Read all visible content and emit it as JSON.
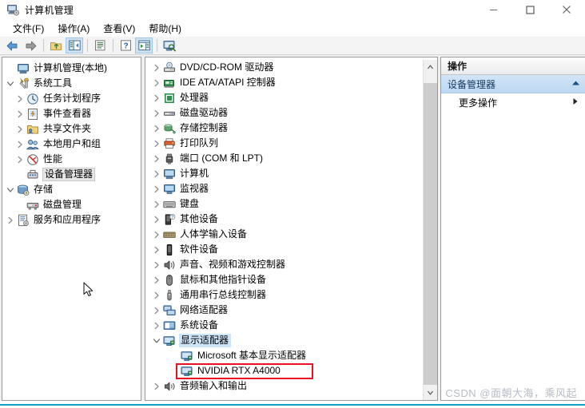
{
  "window": {
    "title": "计算机管理",
    "app_icon": "computer-management-icon",
    "controls": {
      "minimize": "最小化",
      "maximize": "最大化",
      "close": "关闭"
    }
  },
  "menubar": {
    "items": [
      {
        "label": "文件(F)",
        "name": "menu-file"
      },
      {
        "label": "操作(A)",
        "name": "menu-action"
      },
      {
        "label": "查看(V)",
        "name": "menu-view"
      },
      {
        "label": "帮助(H)",
        "name": "menu-help"
      }
    ]
  },
  "toolbar": {
    "buttons": [
      {
        "icon": "back-arrow-icon",
        "label": "后退"
      },
      {
        "icon": "forward-arrow-icon",
        "label": "前进"
      },
      {
        "icon": "up-folder-icon",
        "label": "上移一级"
      },
      {
        "icon": "show-hide-console-tree-icon",
        "label": "显示/隐藏控制台树"
      },
      {
        "icon": "properties-icon",
        "label": "属性"
      },
      {
        "icon": "help-icon",
        "label": "帮助"
      },
      {
        "icon": "show-action-pane-icon",
        "label": "显示/隐藏操作窗格"
      },
      {
        "icon": "scan-hardware-icon",
        "label": "扫描检测硬件改动"
      }
    ]
  },
  "left_tree": {
    "items": [
      {
        "label": "计算机管理(本地)",
        "icon": "computer-icon",
        "indent": 0,
        "twisty": "none",
        "selected": false
      },
      {
        "label": "系统工具",
        "icon": "system-tools-icon",
        "indent": 0,
        "twisty": "expanded",
        "selected": false
      },
      {
        "label": "任务计划程序",
        "icon": "task-scheduler-icon",
        "indent": 1,
        "twisty": "collapsed",
        "selected": false
      },
      {
        "label": "事件查看器",
        "icon": "event-viewer-icon",
        "indent": 1,
        "twisty": "collapsed",
        "selected": false
      },
      {
        "label": "共享文件夹",
        "icon": "shared-folders-icon",
        "indent": 1,
        "twisty": "collapsed",
        "selected": false
      },
      {
        "label": "本地用户和组",
        "icon": "local-users-groups-icon",
        "indent": 1,
        "twisty": "collapsed",
        "selected": false
      },
      {
        "label": "性能",
        "icon": "performance-icon",
        "indent": 1,
        "twisty": "collapsed",
        "selected": false
      },
      {
        "label": "设备管理器",
        "icon": "device-manager-icon",
        "indent": 1,
        "twisty": "none",
        "selected": true
      },
      {
        "label": "存储",
        "icon": "storage-icon",
        "indent": 0,
        "twisty": "expanded",
        "selected": false
      },
      {
        "label": "磁盘管理",
        "icon": "disk-management-icon",
        "indent": 1,
        "twisty": "none",
        "selected": false
      },
      {
        "label": "服务和应用程序",
        "icon": "services-applications-icon",
        "indent": 0,
        "twisty": "collapsed",
        "selected": false
      }
    ]
  },
  "device_tree": {
    "items": [
      {
        "label": "DVD/CD-ROM 驱动器",
        "icon": "dvd-drive-icon",
        "indent": 0,
        "twisty": "collapsed",
        "selected": false,
        "highlighted": false
      },
      {
        "label": "IDE ATA/ATAPI 控制器",
        "icon": "ide-controller-icon",
        "indent": 0,
        "twisty": "collapsed",
        "selected": false,
        "highlighted": false
      },
      {
        "label": "处理器",
        "icon": "processor-icon",
        "indent": 0,
        "twisty": "collapsed",
        "selected": false,
        "highlighted": false
      },
      {
        "label": "磁盘驱动器",
        "icon": "disk-drive-icon",
        "indent": 0,
        "twisty": "collapsed",
        "selected": false,
        "highlighted": false
      },
      {
        "label": "存储控制器",
        "icon": "storage-controller-icon",
        "indent": 0,
        "twisty": "collapsed",
        "selected": false,
        "highlighted": false
      },
      {
        "label": "打印队列",
        "icon": "print-queue-icon",
        "indent": 0,
        "twisty": "collapsed",
        "selected": false,
        "highlighted": false
      },
      {
        "label": "端口 (COM 和 LPT)",
        "icon": "ports-icon",
        "indent": 0,
        "twisty": "collapsed",
        "selected": false,
        "highlighted": false
      },
      {
        "label": "计算机",
        "icon": "computer-icon",
        "indent": 0,
        "twisty": "collapsed",
        "selected": false,
        "highlighted": false
      },
      {
        "label": "监视器",
        "icon": "monitor-icon",
        "indent": 0,
        "twisty": "collapsed",
        "selected": false,
        "highlighted": false
      },
      {
        "label": "键盘",
        "icon": "keyboard-icon",
        "indent": 0,
        "twisty": "collapsed",
        "selected": false,
        "highlighted": false
      },
      {
        "label": "其他设备",
        "icon": "other-devices-icon",
        "indent": 0,
        "twisty": "collapsed",
        "selected": false,
        "highlighted": false
      },
      {
        "label": "人体学输入设备",
        "icon": "hid-icon",
        "indent": 0,
        "twisty": "collapsed",
        "selected": false,
        "highlighted": false
      },
      {
        "label": "软件设备",
        "icon": "software-device-icon",
        "indent": 0,
        "twisty": "collapsed",
        "selected": false,
        "highlighted": false
      },
      {
        "label": "声音、视频和游戏控制器",
        "icon": "sound-video-game-icon",
        "indent": 0,
        "twisty": "collapsed",
        "selected": false,
        "highlighted": false
      },
      {
        "label": "鼠标和其他指针设备",
        "icon": "mouse-icon",
        "indent": 0,
        "twisty": "collapsed",
        "selected": false,
        "highlighted": false
      },
      {
        "label": "通用串行总线控制器",
        "icon": "usb-controller-icon",
        "indent": 0,
        "twisty": "collapsed",
        "selected": false,
        "highlighted": false
      },
      {
        "label": "网络适配器",
        "icon": "network-adapter-icon",
        "indent": 0,
        "twisty": "collapsed",
        "selected": false,
        "highlighted": false
      },
      {
        "label": "系统设备",
        "icon": "system-device-icon",
        "indent": 0,
        "twisty": "collapsed",
        "selected": false,
        "highlighted": false
      },
      {
        "label": "显示适配器",
        "icon": "display-adapter-icon",
        "indent": 0,
        "twisty": "expanded",
        "selected": true,
        "highlighted": false
      },
      {
        "label": "Microsoft 基本显示适配器",
        "icon": "display-adapter-icon",
        "indent": 1,
        "twisty": "none",
        "selected": false,
        "highlighted": false
      },
      {
        "label": "NVIDIA RTX A4000",
        "icon": "display-adapter-icon",
        "indent": 1,
        "twisty": "none",
        "selected": false,
        "highlighted": true
      },
      {
        "label": "音频输入和输出",
        "icon": "audio-io-icon",
        "indent": 0,
        "twisty": "collapsed",
        "selected": false,
        "highlighted": false
      }
    ],
    "highlight_color": "#e81123",
    "selection_color": "#cce4f7"
  },
  "actions_pane": {
    "header": "操作",
    "group_title": "设备管理器",
    "group_caret": "collapse-caret-icon",
    "items": [
      {
        "label": "更多操作",
        "arrow": "submenu-arrow-icon"
      }
    ]
  },
  "scrollbar": {
    "up_arrow": "scroll-up-icon",
    "down_arrow": "scroll-down-icon"
  },
  "watermark": {
    "text": "CSDN @面朝大海，乘风起"
  },
  "colors": {
    "accent_line": "#0e9fc4",
    "highlight_red": "#e81123",
    "selection_blue": "#cce4f7",
    "actions_group": "#bcd8f2"
  }
}
